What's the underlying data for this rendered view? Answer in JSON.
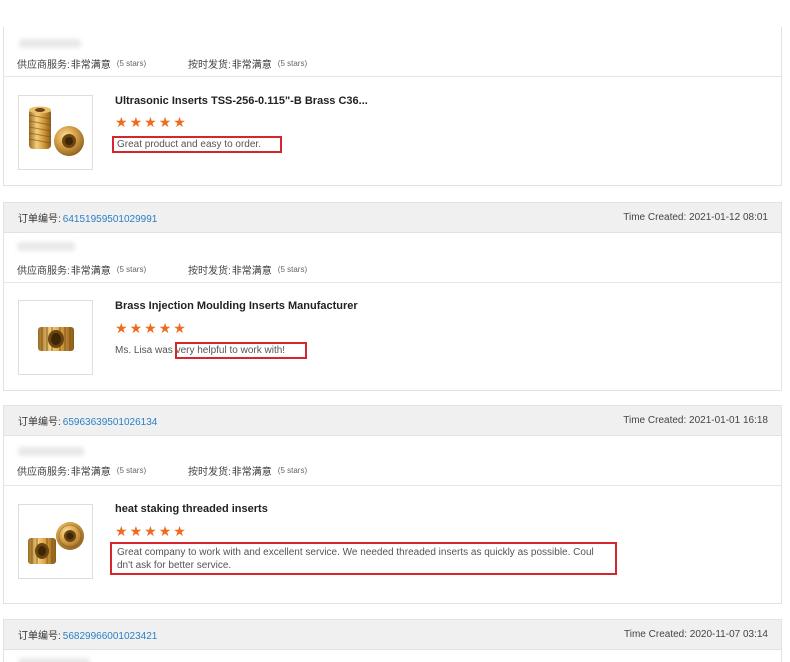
{
  "labels": {
    "order_number": "订单编号:",
    "time_created": "Time Created:",
    "supplier_service": "供应商服务:",
    "on_time_shipping": "按时发货:",
    "very_satisfied": "非常满意",
    "five_stars": "(5 stars)"
  },
  "star_color": "#ef6a1c",
  "highlight_color": "#d6262d",
  "link_color": "#2a7fc6",
  "reviews": [
    {
      "order_no": "",
      "time": "",
      "product": "Ultrasonic Inserts TSS-256-0.115\"-B Brass C36...",
      "rating": 5,
      "comment": "Great product and easy to order.",
      "icon": "brass-insert-pair-icon"
    },
    {
      "order_no": "64151959501029991",
      "time": "2021-01-12 08:01",
      "product": "Brass Injection Moulding Inserts Manufacturer",
      "rating": 5,
      "comment_prefix": "Ms. Lisa was ",
      "comment_highlight": "very helpful to work with!",
      "icon": "brass-insert-icon"
    },
    {
      "order_no": "65963639501026134",
      "time": "2021-01-01 16:18",
      "product": "heat staking threaded inserts",
      "rating": 5,
      "comment_line1": "Great company to work with and excellent service. We needed threaded inserts as quickly as possible. Coul",
      "comment_line2": "dn't ask for better service.",
      "icon": "threaded-insert-pair-icon"
    },
    {
      "order_no": "56829966001023421",
      "time": "2020-11-07 03:14"
    }
  ]
}
